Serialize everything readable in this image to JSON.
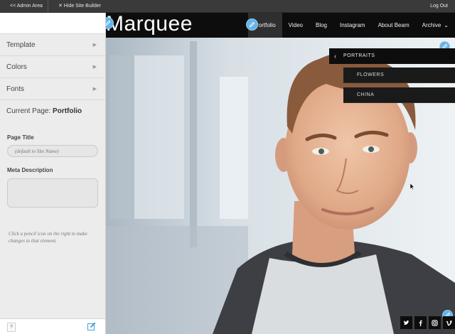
{
  "admin_bar": {
    "admin_area": "<< Admin Area",
    "hide_builder": "✕ Hide Site Builder",
    "logout": "Log Out"
  },
  "panel": {
    "menu": [
      {
        "label": "Template"
      },
      {
        "label": "Colors"
      },
      {
        "label": "Fonts"
      }
    ],
    "current_page_prefix": "Current Page:",
    "current_page_name": "Portfolio",
    "page_title_label": "Page Title",
    "page_title_placeholder": "(default to Site Name)",
    "meta_label": "Meta Description",
    "meta_value": "",
    "hint": "Click a pencil icon on the right to make changes to that element.",
    "help": "?"
  },
  "site": {
    "title": "Marquee",
    "nav": [
      {
        "label": "Portfolio",
        "active": true
      },
      {
        "label": "Video"
      },
      {
        "label": "Blog"
      },
      {
        "label": "Instagram"
      },
      {
        "label": "About Beam"
      },
      {
        "label": "Archive"
      }
    ],
    "submenu": {
      "title": "PORTRAITS",
      "items": [
        "FLOWERS",
        "CHINA"
      ]
    },
    "social": [
      "twitter-icon",
      "facebook-icon",
      "instagram-icon",
      "vimeo-icon"
    ]
  },
  "colors": {
    "accent_pencil": "#67b4e6",
    "header_bg": "#0d0d0d"
  }
}
